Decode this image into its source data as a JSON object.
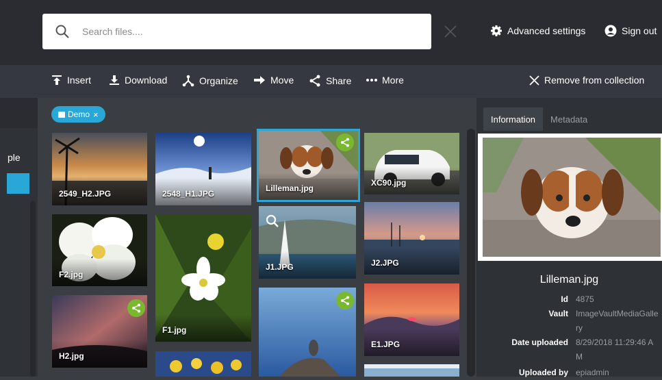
{
  "search": {
    "placeholder": "Search files...."
  },
  "top_actions": {
    "advanced_settings": "Advanced settings",
    "sign_out": "Sign out"
  },
  "toolbar": {
    "insert": "Insert",
    "download": "Download",
    "organize": "Organize",
    "move": "Move",
    "share": "Share",
    "more": "More",
    "remove_from_collection": "Remove from collection"
  },
  "left_panel": {
    "item_text": "ple"
  },
  "filter_chip": {
    "label": "Demo",
    "close": "×"
  },
  "files": [
    {
      "name": "2549_H2.JPG",
      "shared": false,
      "selected": false
    },
    {
      "name": "2548_H1.JPG",
      "shared": false,
      "selected": false
    },
    {
      "name": "Lilleman.jpg",
      "shared": true,
      "selected": true
    },
    {
      "name": "XC90.jpg",
      "shared": false,
      "selected": false
    },
    {
      "name": "F2.jpg",
      "shared": false,
      "selected": false
    },
    {
      "name": "F1.jpg",
      "shared": false,
      "selected": false
    },
    {
      "name": "J1.JPG",
      "shared": false,
      "selected": false
    },
    {
      "name": "J2.JPG",
      "shared": false,
      "selected": false
    },
    {
      "name": "H2.jpg",
      "shared": true,
      "selected": false
    },
    {
      "name": "",
      "shared": false,
      "selected": false
    },
    {
      "name": "",
      "shared": true,
      "selected": false
    },
    {
      "name": "E1.JPG",
      "shared": false,
      "selected": false
    },
    {
      "name": "",
      "shared": false,
      "selected": false
    }
  ],
  "details": {
    "tabs": [
      "Information",
      "Metadata"
    ],
    "file_name": "Lilleman.jpg",
    "fields": [
      {
        "key": "Id",
        "value": "4875"
      },
      {
        "key": "Vault",
        "value": "ImageVaultMediaGallery"
      },
      {
        "key": "Date uploaded",
        "value": "8/29/2018 11:29:46 AM"
      },
      {
        "key": "Uploaded by",
        "value": "epiadmin"
      }
    ]
  },
  "colors": {
    "accent": "#29a8d8",
    "share_badge": "#7ab830",
    "topbar": "#2a2c31",
    "toolbar": "#353840"
  }
}
